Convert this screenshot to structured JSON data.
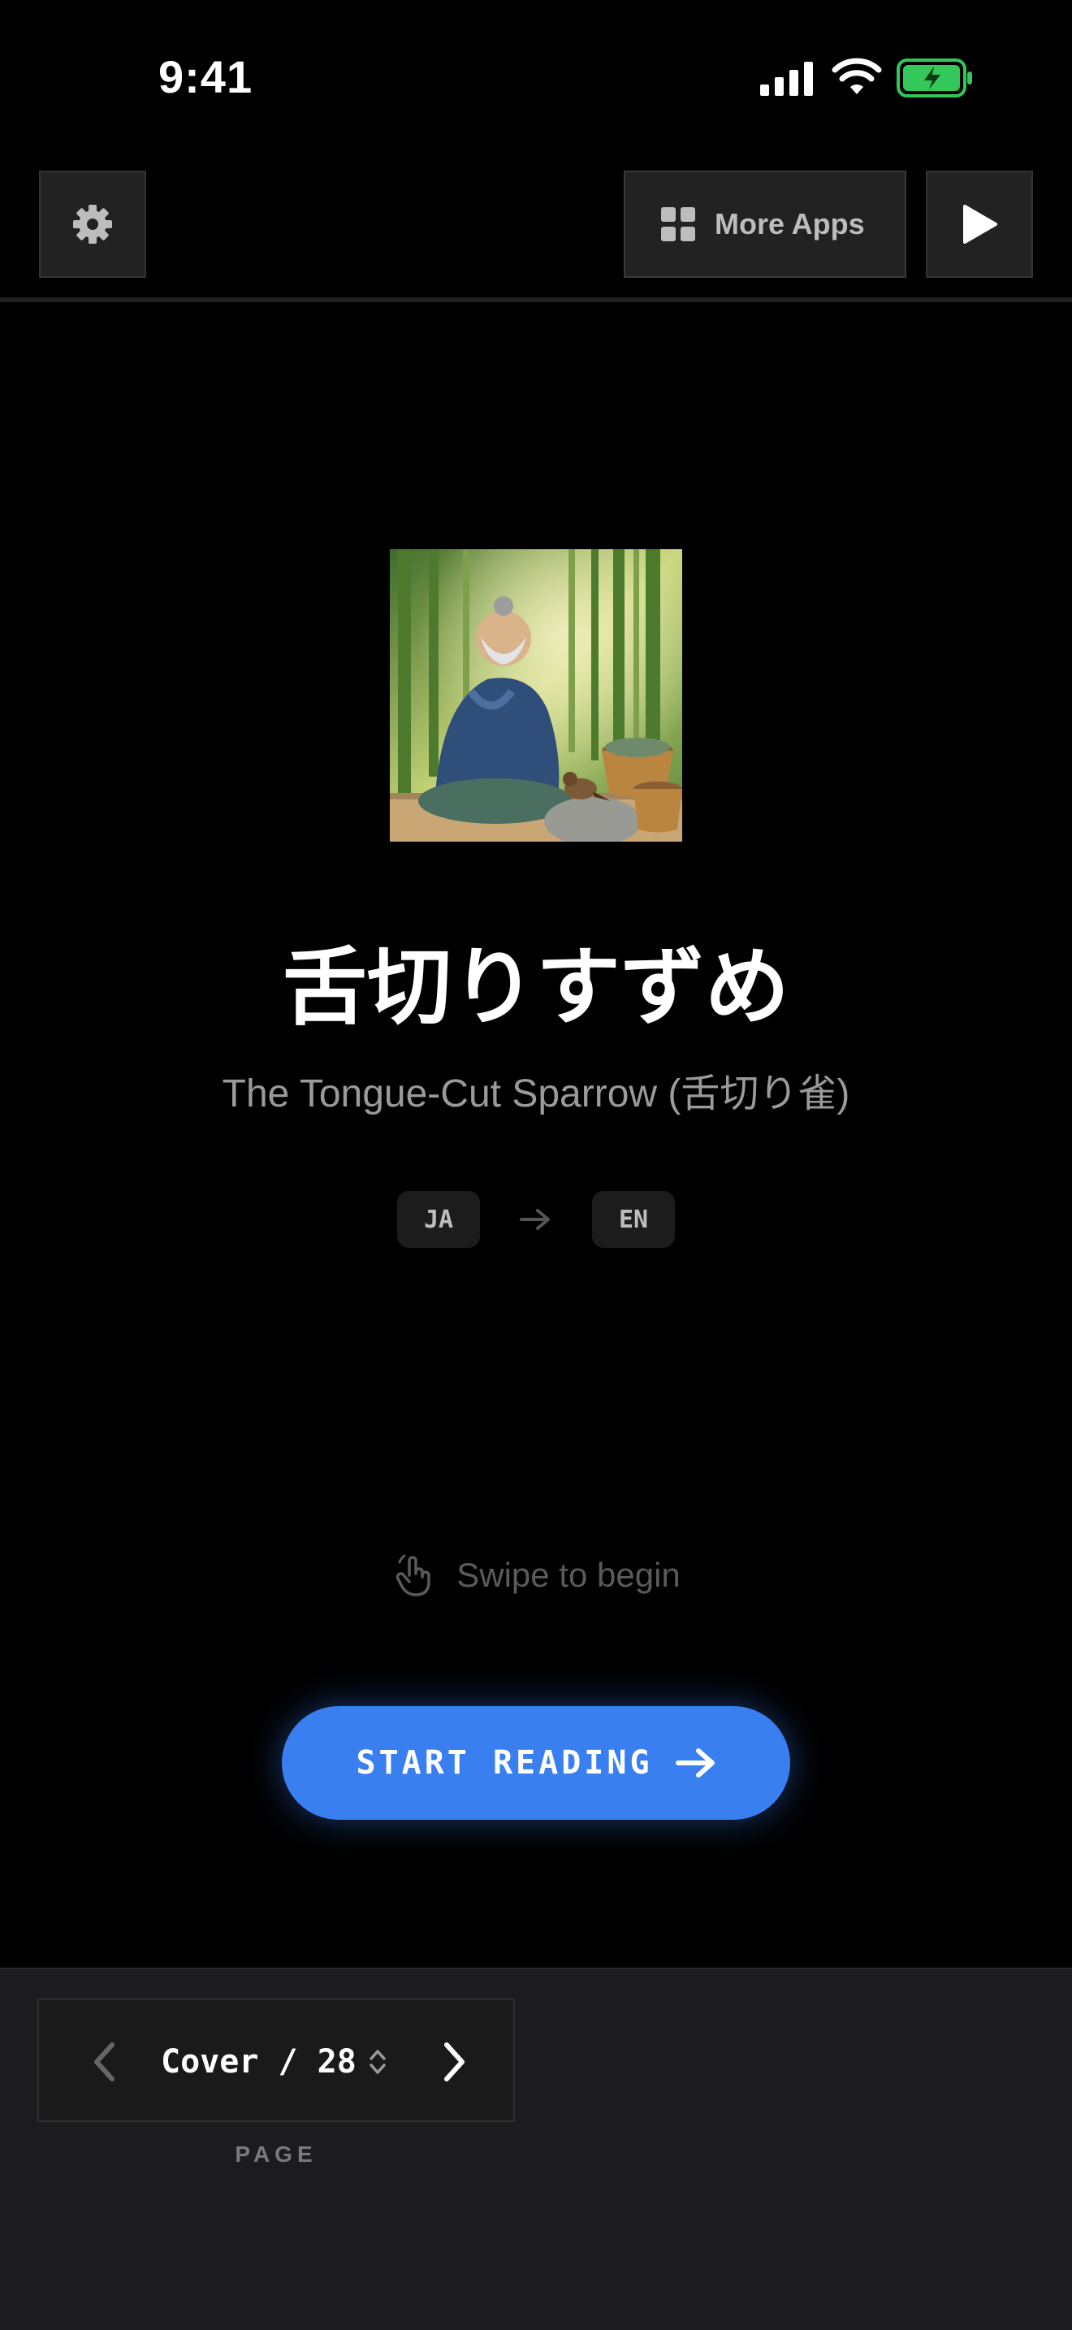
{
  "status_bar": {
    "time": "9:41",
    "icons": [
      "cellular-signal-icon",
      "wifi-icon",
      "battery-charging-icon"
    ]
  },
  "toolbar": {
    "settings_icon": "gear-icon",
    "more_apps_label": "More Apps",
    "more_apps_icon": "grid-icon",
    "play_icon": "play-icon"
  },
  "cover": {
    "image": "illustration of an old man in a bamboo forest with a sparrow",
    "title": "舌切りすずめ",
    "subtitle": "The Tongue-Cut Sparrow (舌切り雀)",
    "source_lang": "JA",
    "target_lang": "EN"
  },
  "swipe_hint": {
    "icon": "hand-pointer-icon",
    "label": "Swipe to begin"
  },
  "start_button": {
    "label": "START READING",
    "icon": "arrow-right-icon"
  },
  "page_nav": {
    "current": "Cover / 28",
    "caption": "PAGE"
  },
  "colors": {
    "background": "#000000",
    "accent": "#3a7ff0",
    "bottom_bar": "#1c1c1e",
    "battery": "#34c759"
  }
}
